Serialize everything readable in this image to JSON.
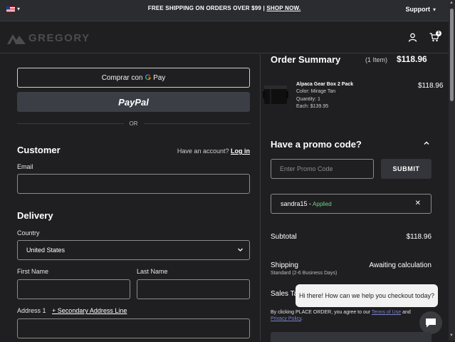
{
  "topbar": {
    "promo_text": "FREE SHIPPING ON ORDERS OVER $99 | ",
    "promo_link": "SHOP NOW.",
    "support_label": "Support"
  },
  "header": {
    "logo_text": "GREGORY",
    "cart_count": "1"
  },
  "checkout": {
    "gpay_label": "Comprar con",
    "gpay_brand": "Pay",
    "paypal_label": "PayPal",
    "or_label": "OR",
    "customer_heading": "Customer",
    "have_account_text": "Have an account?",
    "login_link": "Log in",
    "email_label": "Email",
    "delivery_heading": "Delivery",
    "country_label": "Country",
    "country_value": "United States",
    "first_name_label": "First Name",
    "last_name_label": "Last Name",
    "address1_label": "Address 1",
    "secondary_address_link": "+ Secondary Address Line"
  },
  "summary": {
    "title": "Order Summary",
    "item_count": "(1 Item)",
    "total": "$118.96",
    "product": {
      "name": "Alpaca Gear Box 2 Pack",
      "color": "Color: Mirage Tan",
      "quantity": "Quantity: 1",
      "each": "Each: $139.95",
      "price": "$118.96"
    },
    "promo_heading": "Have a promo code?",
    "promo_placeholder": "Enter Promo Code",
    "submit_label": "SUBMIT",
    "applied_code": "sandra15 -",
    "applied_tag": "Applied",
    "subtotal_label": "Subtotal",
    "subtotal_value": "$118.96",
    "shipping_label": "Shipping",
    "shipping_value": "Awaiting calculation",
    "shipping_sub": "Standard (2-6 Business Days)",
    "sales_tax_label": "Sales Ta",
    "terms_pre": "By clicking PLACE ORDER, you agree to our ",
    "terms_link": "Terms of Use",
    "terms_mid": " and ",
    "privacy_link": "Privacy Policy",
    "terms_end": "."
  },
  "chat": {
    "bubble_text": "Hi there! How can we help you checkout today?"
  }
}
